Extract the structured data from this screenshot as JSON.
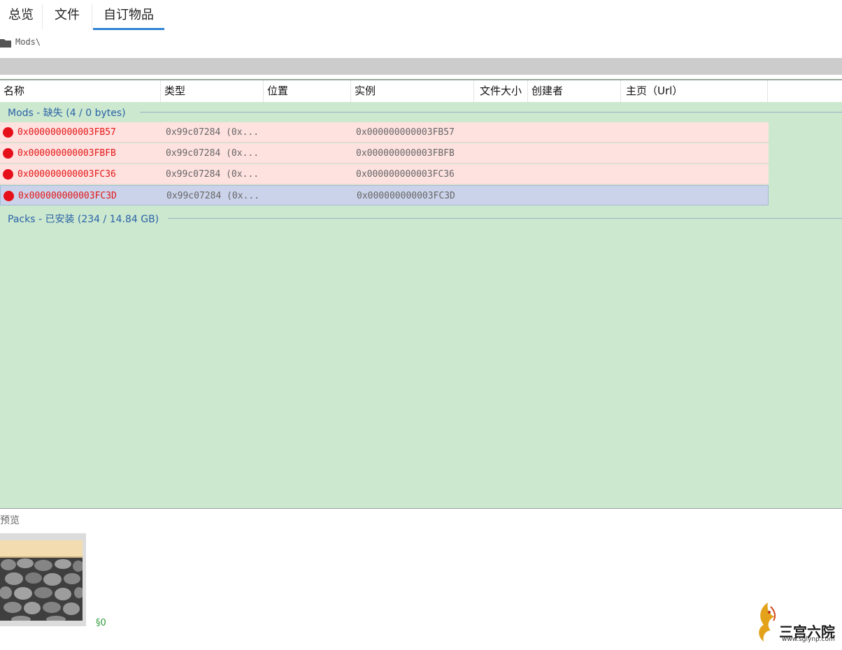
{
  "tabs": [
    {
      "label": "总览"
    },
    {
      "label": "文件"
    },
    {
      "label": "自订物品"
    }
  ],
  "breadcrumb": {
    "path": "Mods\\"
  },
  "columns": [
    "名称",
    "类型",
    "位置",
    "实例",
    "文件大小",
    "创建者",
    "主页（Url）"
  ],
  "groups": [
    {
      "label": "Mods - 缺失  (4 / 0 bytes)"
    },
    {
      "label": "Packs - 已安装  (234 / 14.84 GB)"
    }
  ],
  "rows": [
    {
      "name": "0x000000000003FB57",
      "type": "0x99c07284 (0x...",
      "instance": "0x000000000003FB57",
      "selected": false
    },
    {
      "name": "0x000000000003FBFB",
      "type": "0x99c07284 (0x...",
      "instance": "0x000000000003FBFB",
      "selected": false
    },
    {
      "name": "0x000000000003FC36",
      "type": "0x99c07284 (0x...",
      "instance": "0x000000000003FC36",
      "selected": false
    },
    {
      "name": "0x000000000003FC3D",
      "type": "0x99c07284 (0x...",
      "instance": "0x000000000003FC3D",
      "selected": true
    }
  ],
  "colors": {
    "accent": "#2f82d4",
    "missing_text": "#e31616",
    "grid_bg": "#cce8cf",
    "missing_row": "#fee2e0",
    "selected_row": "#cbd3ea"
  },
  "icons": {
    "breadcrumb": "folder-icon",
    "row_status": "red-dot-icon"
  },
  "preview": {
    "label": "预览",
    "value": "§0"
  },
  "watermark": {
    "text": "三宫六院",
    "url": "www.sglynp.com"
  }
}
